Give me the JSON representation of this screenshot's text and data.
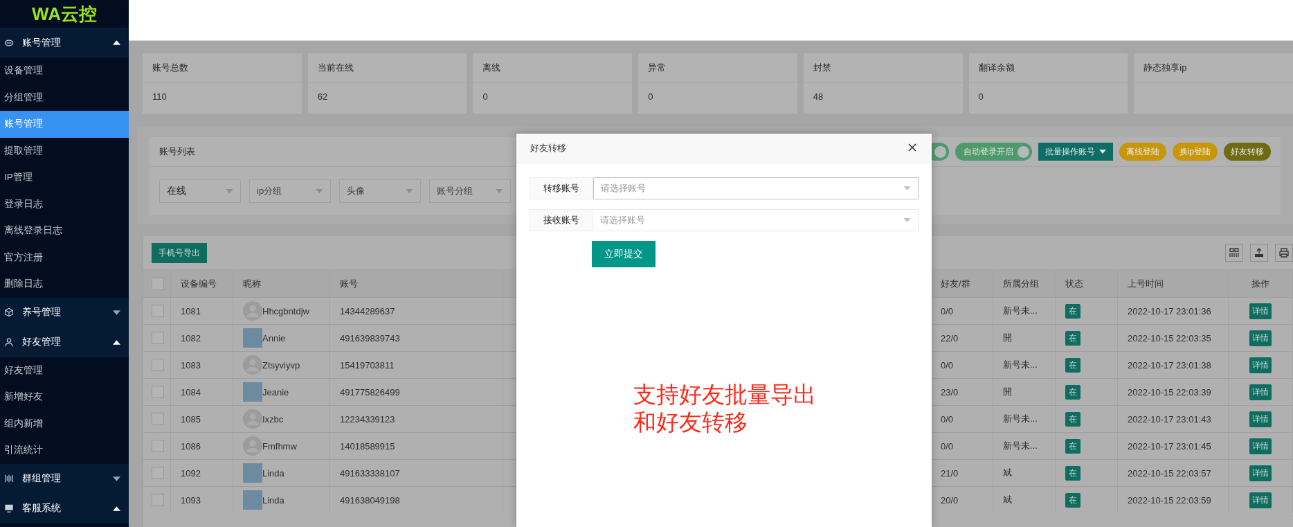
{
  "sidebar": {
    "logo": "WA云控",
    "groups": [
      {
        "label": "账号管理",
        "expanded": true,
        "items": [
          {
            "label": "设备管理",
            "selected": false
          },
          {
            "label": "分组管理",
            "selected": false
          },
          {
            "label": "账号管理",
            "selected": true
          },
          {
            "label": "提取管理",
            "selected": false
          },
          {
            "label": "IP管理",
            "selected": false
          },
          {
            "label": "登录日志",
            "selected": false
          },
          {
            "label": "离线登录日志",
            "selected": false
          },
          {
            "label": "官方注册",
            "selected": false
          },
          {
            "label": "删除日志",
            "selected": false
          }
        ]
      },
      {
        "label": "养号管理",
        "expanded": false
      },
      {
        "label": "好友管理",
        "expanded": true,
        "items": [
          {
            "label": "好友管理",
            "selected": false
          },
          {
            "label": "新增好友",
            "selected": false
          },
          {
            "label": "组内新增",
            "selected": false
          },
          {
            "label": "引流统计",
            "selected": false
          }
        ]
      },
      {
        "label": "群组管理",
        "expanded": false
      },
      {
        "label": "客服系统",
        "expanded": true
      }
    ]
  },
  "stats": [
    {
      "label": "账号总数",
      "value": "110"
    },
    {
      "label": "当前在线",
      "value": "62"
    },
    {
      "label": "离线",
      "value": "0"
    },
    {
      "label": "异常",
      "value": "0"
    },
    {
      "label": "封禁",
      "value": "48"
    },
    {
      "label": "翻译余额",
      "value": "0"
    },
    {
      "label": "静态独享ip"
    }
  ],
  "account_list": {
    "title": "账号列表",
    "toggles": [
      {
        "on": true
      },
      {
        "label": "自动登录开启",
        "on": true
      }
    ],
    "buttons": [
      {
        "label": "批量操作账号",
        "kind": "dropdown"
      },
      {
        "label": "离线登陆",
        "kind": "warning"
      },
      {
        "label": "换ip登陆",
        "kind": "warning"
      },
      {
        "label": "好友转移",
        "kind": "olive"
      }
    ],
    "filters": [
      {
        "value": "在线"
      },
      {
        "placeholder": "ip分组"
      },
      {
        "placeholder": "头像"
      },
      {
        "placeholder": "账号分组"
      }
    ]
  },
  "table": {
    "export_button": "手机号导出",
    "all_checked": false,
    "columns": [
      "设备编号",
      "昵称",
      "账号",
      "好友/群",
      "所属分组",
      "状态",
      "上号时间",
      "操作"
    ],
    "rows": [
      {
        "checked": false,
        "device": "1081",
        "has_photo": false,
        "nickname": "Hhcgbntdjw",
        "account": "14344289637",
        "friends": "0/0",
        "group": "新号未...",
        "status": "在",
        "time": "2022-10-17 23:01:36",
        "action": "详情"
      },
      {
        "checked": false,
        "device": "1082",
        "has_photo": true,
        "nickname": "Annie",
        "account": "491639839743",
        "friends": "22/0",
        "group": "開",
        "status": "在",
        "time": "2022-10-15 22:03:35",
        "action": "详情"
      },
      {
        "checked": false,
        "device": "1083",
        "has_photo": false,
        "nickname": "Ztsyviyvp",
        "account": "15419703811",
        "friends": "0/0",
        "group": "新号未...",
        "status": "在",
        "time": "2022-10-17 23:01:38",
        "action": "详情"
      },
      {
        "checked": false,
        "device": "1084",
        "has_photo": true,
        "nickname": "Jeanie",
        "account": "491775826499",
        "friends": "23/0",
        "group": "開",
        "status": "在",
        "time": "2022-10-15 22:03:39",
        "action": "详情"
      },
      {
        "checked": false,
        "device": "1085",
        "has_photo": false,
        "nickname": "Ixzbc",
        "account": "12234339123",
        "friends": "0/0",
        "group": "新号未...",
        "status": "在",
        "time": "2022-10-17 23:01:43",
        "action": "详情"
      },
      {
        "checked": false,
        "device": "1086",
        "has_photo": false,
        "nickname": "Fmfhmw",
        "account": "14018589915",
        "friends": "0/0",
        "group": "新号未...",
        "status": "在",
        "time": "2022-10-17 23:01:45",
        "action": "详情"
      },
      {
        "checked": false,
        "device": "1092",
        "has_photo": true,
        "nickname": "Linda",
        "account": "491633338107",
        "friends": "21/0",
        "group": "斌",
        "status": "在",
        "time": "2022-10-15 22:03:57",
        "action": "详情"
      },
      {
        "checked": false,
        "device": "1093",
        "has_photo": true,
        "nickname": "Linda",
        "account": "491638049198",
        "friends": "20/0",
        "group": "斌",
        "status": "在",
        "time": "2022-10-15 22:03:59",
        "action": "详情"
      }
    ]
  },
  "modal": {
    "title": "好友转移",
    "fields": [
      {
        "label": "转移账号",
        "placeholder": "请选择账号",
        "focused": true
      },
      {
        "label": "接收账号",
        "placeholder": "请选择账号",
        "focused": false
      }
    ],
    "submit": "立即提交"
  },
  "annotation": [
    "支持好友批量导出",
    "和好友转移"
  ]
}
